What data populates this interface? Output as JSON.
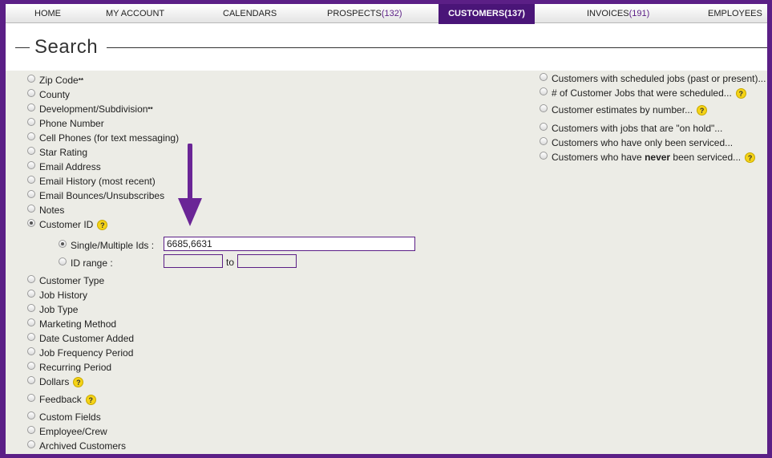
{
  "nav": {
    "home": "HOME",
    "my_account": "MY ACCOUNT",
    "calendars": "CALENDARS",
    "prospects": "PROSPECTS",
    "prospects_count": "(132)",
    "customers": "CUSTOMERS",
    "customers_count": "(137)",
    "invoices": "INVOICES",
    "invoices_count": "(191)",
    "employees": "EMPLOYEES"
  },
  "page_title": "Search",
  "left_options": {
    "zip_code": "Zip Code",
    "county": "County",
    "development": "Development/Subdivision",
    "phone": "Phone Number",
    "cell": "Cell Phones (for text messaging)",
    "star": "Star Rating",
    "email": "Email Address",
    "email_history": "Email History (most recent)",
    "email_bounces": "Email Bounces/Unsubscribes",
    "notes": "Notes",
    "customer_id": "Customer ID",
    "customer_type": "Customer Type",
    "job_history": "Job History",
    "job_type": "Job Type",
    "marketing": "Marketing Method",
    "date_added": "Date Customer Added",
    "job_frequency": "Job Frequency Period",
    "recurring": "Recurring Period",
    "dollars": "Dollars",
    "feedback": "Feedback",
    "custom_fields": "Custom Fields",
    "employee_crew": "Employee/Crew",
    "archived": "Archived Customers",
    "asterisks": "**"
  },
  "customer_id_sub": {
    "single_label": "Single/Multiple Ids :",
    "single_value": "6685,6631",
    "range_label": "ID range :",
    "range_to": "to",
    "range_from_value": "",
    "range_to_value": ""
  },
  "right_options": {
    "scheduled": "Customers with scheduled jobs (past or present)...",
    "num_jobs": "# of Customer Jobs that were scheduled...",
    "estimates": "Customer estimates by number...",
    "on_hold": "Customers with jobs that are \"on hold\"...",
    "only_serviced": "Customers who have only been serviced...",
    "never_pre": "Customers who have ",
    "never_bold": "never",
    "never_post": " been serviced..."
  },
  "help_glyph": "?",
  "colors": {
    "brand_purple": "#5b1f86",
    "active_tab": "#4a1578",
    "help_yellow": "#f5d317",
    "panel_bg": "#ececE6"
  }
}
